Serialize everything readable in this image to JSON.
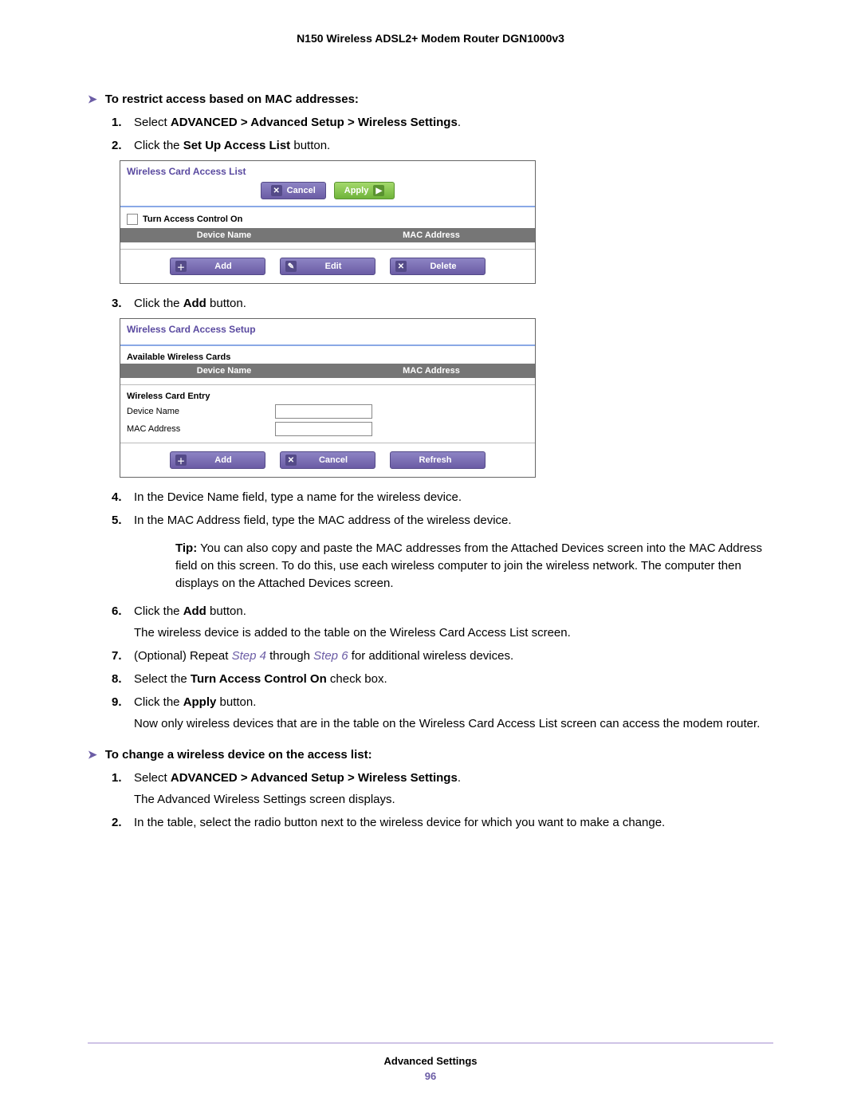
{
  "header": {
    "title": "N150 Wireless ADSL2+ Modem Router DGN1000v3"
  },
  "procedures": [
    {
      "heading": "To restrict access based on MAC addresses:",
      "steps": [
        {
          "num": "1.",
          "pre": "Select ",
          "bold": "ADVANCED > Advanced Setup > Wireless Settings",
          "post": "."
        },
        {
          "num": "2.",
          "pre": "Click the ",
          "bold": "Set Up Access List",
          "post": " button."
        }
      ]
    }
  ],
  "panel1": {
    "title": "Wireless Card Access List",
    "cancel": "Cancel",
    "apply": "Apply",
    "turn_on_label": "Turn Access Control On",
    "col_device": "Device Name",
    "col_mac": "MAC Address",
    "add": "Add",
    "edit": "Edit",
    "delete": "Delete"
  },
  "step3": {
    "num": "3.",
    "pre": "Click the ",
    "bold": "Add",
    "post": " button."
  },
  "panel2": {
    "title": "Wireless Card Access Setup",
    "available": "Available Wireless Cards",
    "col_device": "Device Name",
    "col_mac": "MAC Address",
    "entry": "Wireless Card Entry",
    "dev_label": "Device Name",
    "mac_label": "MAC Address",
    "add": "Add",
    "cancel": "Cancel",
    "refresh": "Refresh"
  },
  "steps_after": {
    "s4": {
      "num": "4.",
      "text": "In the Device Name field, type a name for the wireless device."
    },
    "s5": {
      "num": "5.",
      "text": "In the MAC Address field, type the MAC address of the wireless device."
    },
    "tip_label": "Tip:",
    "tip_text": " You can also copy and paste the MAC addresses from the Attached Devices screen into the MAC Address field on this screen. To do this, use each wireless computer to join the wireless network. The computer then displays on the Attached Devices screen.",
    "s6": {
      "num": "6.",
      "pre": "Click the ",
      "bold": "Add",
      "post": " button."
    },
    "s6_sub": "The wireless device is added to the table on the Wireless Card Access List screen.",
    "s7_num": "7.",
    "s7_a": "(Optional) Repeat ",
    "s7_ref1": "Step 4",
    "s7_b": " through ",
    "s7_ref2": "Step 6",
    "s7_c": " for additional wireless devices.",
    "s8": {
      "num": "8.",
      "pre": "Select the ",
      "bold": "Turn Access Control On",
      "post": " check box."
    },
    "s9": {
      "num": "9.",
      "pre": "Click the ",
      "bold": "Apply",
      "post": " button."
    },
    "s9_sub": "Now only wireless devices that are in the table on the Wireless Card Access List screen can access the modem router."
  },
  "procedure2": {
    "heading": "To change a wireless device on the access list:",
    "s1": {
      "num": "1.",
      "pre": "Select ",
      "bold": "ADVANCED > Advanced Setup > Wireless Settings",
      "post": "."
    },
    "s1_sub": "The Advanced Wireless Settings screen displays.",
    "s2": {
      "num": "2.",
      "text": "In the table, select the radio button next to the wireless device for which you want to make a change."
    }
  },
  "footer": {
    "section": "Advanced Settings",
    "page_number": "96"
  }
}
